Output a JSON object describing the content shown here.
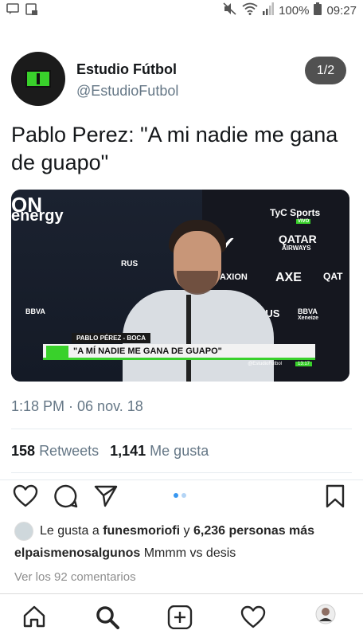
{
  "status_bar": {
    "battery": "100%",
    "time": "09:27"
  },
  "tweet": {
    "display_name": "Estudio Fútbol",
    "handle": "@EstudioFutbol",
    "page_indicator": "1/2",
    "text": "Pablo Perez: \"A mi nadie me gana de guapo\"",
    "timestamp": "1:18 PM · 06 nov. 18",
    "retweets_count": "158",
    "retweets_label": "Retweets",
    "likes_count": "1,141",
    "likes_label": "Me gusta",
    "media": {
      "tag": "PABLO PÉREZ - BOCA",
      "headline": "\"A MÍ NADIE ME GANA DE GUAPO\"",
      "handle": "@EstudioFutbol",
      "clock": "13:17",
      "ads": {
        "energy": "energy",
        "tyc": "TyC Sports",
        "vivo": "VIVO",
        "qatar": "QATAR",
        "airways": "AIRWAYS",
        "axion": "AXION",
        "axe": "AXE",
        "rus": "RUS",
        "bbva": "BBVA",
        "xeneize": "Xeneize"
      }
    }
  },
  "instagram": {
    "carousel": {
      "count": 2,
      "active_index": 0
    },
    "likes_prefix": "Le gusta a",
    "likes_user": "funesmoriofi",
    "likes_and": "y",
    "likes_others": "6,236 personas más",
    "caption_user": "elpaismenosalgunos",
    "caption_text": "Mmmm vs desis",
    "view_comments": "Ver los 92 comentarios"
  },
  "icons": {
    "notification": "message-icon",
    "gallery": "image-icon",
    "mute": "mute-icon",
    "wifi": "wifi-icon",
    "signal": "signal-icon",
    "battery": "battery-icon",
    "heart": "heart-icon",
    "comment": "comment-icon",
    "share": "send-icon",
    "save": "bookmark-icon",
    "home": "home-icon",
    "search": "search-icon",
    "new_post": "add-post-icon",
    "activity": "heart-icon",
    "profile": "profile-avatar"
  },
  "colors": {
    "twitter_text": "#14171a",
    "twitter_gray": "#657786",
    "brand_green": "#39d12b",
    "instagram_blue": "#3897f0"
  }
}
